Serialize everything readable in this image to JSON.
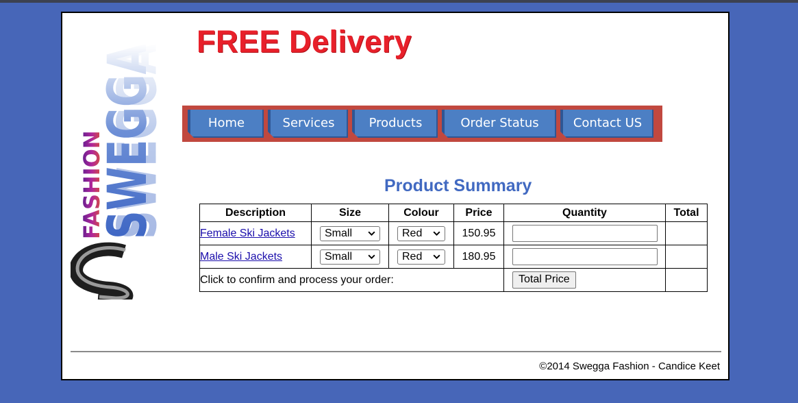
{
  "promo": {
    "text": "FREE Delivery"
  },
  "logo": {
    "word1": "FASHION",
    "word2": "SWEGGA"
  },
  "nav": {
    "items": [
      "Home",
      "Services",
      "Products",
      "Order Status",
      "Contact US"
    ]
  },
  "summary": {
    "title": "Product Summary",
    "headers": [
      "Description",
      "Size",
      "Colour",
      "Price",
      "Quantity",
      "Total"
    ],
    "rows": [
      {
        "description": "Female Ski Jackets",
        "size": "Small",
        "colour": "Red",
        "price": "150.95",
        "quantity": "",
        "total": ""
      },
      {
        "description": "Male Ski Jackets",
        "size": "Small",
        "colour": "Red",
        "price": "180.95",
        "quantity": "",
        "total": ""
      }
    ],
    "confirm_text": "Click to confirm and process your order:",
    "button_label": "Total Price"
  },
  "footer": {
    "text": "©2014 Swegga Fashion - Candice Keet"
  },
  "colors": {
    "background": "#4766b8",
    "promo": "#e8202a",
    "title": "#4169c1",
    "nav_bar": "#c1483f",
    "nav_button": "#4c7fc4"
  }
}
